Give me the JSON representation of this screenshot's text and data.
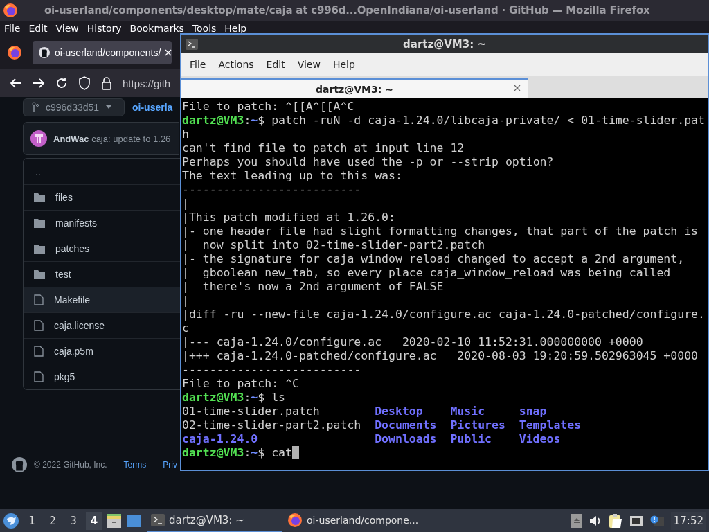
{
  "firefox": {
    "title": "oi-userland/components/desktop/mate/caja at c996d...OpenIndiana/oi-userland · GitHub — Mozilla Firefox",
    "menu": [
      "File",
      "Edit",
      "View",
      "History",
      "Bookmarks",
      "Tools",
      "Help"
    ],
    "tab": {
      "title": "oi-userland/components/"
    },
    "url": "https://gith",
    "page": {
      "branch": "c996d33d51",
      "repo_link": "oi-userla",
      "commit": {
        "author": "AndWac",
        "message": "caja: update to 1.26"
      },
      "files": [
        {
          "name": "..",
          "kind": "parent",
          "hovered": false
        },
        {
          "name": "files",
          "kind": "folder",
          "hovered": false
        },
        {
          "name": "manifests",
          "kind": "folder",
          "hovered": false
        },
        {
          "name": "patches",
          "kind": "folder",
          "hovered": false
        },
        {
          "name": "test",
          "kind": "folder",
          "hovered": false
        },
        {
          "name": "Makefile",
          "kind": "file",
          "hovered": true
        },
        {
          "name": "caja.license",
          "kind": "file",
          "hovered": false
        },
        {
          "name": "caja.p5m",
          "kind": "file",
          "hovered": false
        },
        {
          "name": "pkg5",
          "kind": "file",
          "hovered": false
        }
      ],
      "footer": {
        "copyright": "© 2022 GitHub, Inc.",
        "links": [
          "Terms",
          "Priv"
        ]
      }
    }
  },
  "terminal": {
    "title": "dartz@VM3: ~",
    "menu": [
      "File",
      "Actions",
      "Edit",
      "View",
      "Help"
    ],
    "tabs": [
      {
        "label": "dartz@VM3: ~",
        "selected": true
      }
    ],
    "cursor": true,
    "lines": [
      {
        "kind": "output",
        "segments": [
          {
            "kind": "text",
            "text": "File to patch: ^[[A^[[A^C"
          }
        ]
      },
      {
        "kind": "output",
        "segments": [
          {
            "kind": "user",
            "text": "dartz@VM3"
          },
          {
            "kind": "text",
            "text": ":"
          },
          {
            "kind": "path",
            "text": "~"
          },
          {
            "kind": "text",
            "text": "$ patch -ruN -d caja-1.24.0/libcaja-private/ < 01-time-slider.pat"
          }
        ]
      },
      {
        "kind": "output",
        "segments": [
          {
            "kind": "text",
            "text": "h"
          }
        ]
      },
      {
        "kind": "output",
        "segments": [
          {
            "kind": "text",
            "text": "can't find file to patch at input line 12"
          }
        ]
      },
      {
        "kind": "output",
        "segments": [
          {
            "kind": "text",
            "text": "Perhaps you should have used the -p or --strip option?"
          }
        ]
      },
      {
        "kind": "output",
        "segments": [
          {
            "kind": "text",
            "text": "The text leading up to this was:"
          }
        ]
      },
      {
        "kind": "output",
        "segments": [
          {
            "kind": "text",
            "text": "--------------------------"
          }
        ]
      },
      {
        "kind": "output",
        "segments": [
          {
            "kind": "text",
            "text": "|"
          }
        ]
      },
      {
        "kind": "output",
        "segments": [
          {
            "kind": "text",
            "text": "|This patch modified at 1.26.0:"
          }
        ]
      },
      {
        "kind": "output",
        "segments": [
          {
            "kind": "text",
            "text": "|- one header file had slight formatting changes, that part of the patch is"
          }
        ]
      },
      {
        "kind": "output",
        "segments": [
          {
            "kind": "text",
            "text": "|  now split into 02-time-slider-part2.patch"
          }
        ]
      },
      {
        "kind": "output",
        "segments": [
          {
            "kind": "text",
            "text": "|- the signature for caja_window_reload changed to accept a 2nd argument,"
          }
        ]
      },
      {
        "kind": "output",
        "segments": [
          {
            "kind": "text",
            "text": "|  gboolean new_tab, so every place caja_window_reload was being called"
          }
        ]
      },
      {
        "kind": "output",
        "segments": [
          {
            "kind": "text",
            "text": "|  there's now a 2nd argument of FALSE"
          }
        ]
      },
      {
        "kind": "output",
        "segments": [
          {
            "kind": "text",
            "text": "|"
          }
        ]
      },
      {
        "kind": "output",
        "segments": [
          {
            "kind": "text",
            "text": "|diff -ru --new-file caja-1.24.0/configure.ac caja-1.24.0-patched/configure."
          }
        ]
      },
      {
        "kind": "output",
        "segments": [
          {
            "kind": "text",
            "text": "c"
          }
        ]
      },
      {
        "kind": "output",
        "segments": [
          {
            "kind": "text",
            "text": "|--- caja-1.24.0/configure.ac   2020-02-10 11:52:31.000000000 +0000"
          }
        ]
      },
      {
        "kind": "output",
        "segments": [
          {
            "kind": "text",
            "text": "|+++ caja-1.24.0-patched/configure.ac   2020-08-03 19:20:59.502963045 +0000"
          }
        ]
      },
      {
        "kind": "output",
        "segments": [
          {
            "kind": "text",
            "text": "--------------------------"
          }
        ]
      },
      {
        "kind": "output",
        "segments": [
          {
            "kind": "text",
            "text": "File to patch: ^C"
          }
        ]
      },
      {
        "kind": "output",
        "segments": [
          {
            "kind": "user",
            "text": "dartz@VM3"
          },
          {
            "kind": "text",
            "text": ":"
          },
          {
            "kind": "path",
            "text": "~"
          },
          {
            "kind": "text",
            "text": "$ ls"
          }
        ]
      },
      {
        "kind": "ls",
        "entries": [
          {
            "kind": "text",
            "text": "01-time-slider.patch"
          },
          {
            "kind": "dir",
            "text": "Desktop"
          },
          {
            "kind": "dir",
            "text": "Music"
          },
          {
            "kind": "dir",
            "text": "snap"
          }
        ]
      },
      {
        "kind": "ls",
        "entries": [
          {
            "kind": "text",
            "text": "02-time-slider-part2.patch"
          },
          {
            "kind": "dir",
            "text": "Documents"
          },
          {
            "kind": "dir",
            "text": "Pictures"
          },
          {
            "kind": "dir",
            "text": "Templates"
          }
        ]
      },
      {
        "kind": "ls",
        "entries": [
          {
            "kind": "dir",
            "text": "caja-1.24.0"
          },
          {
            "kind": "dir",
            "text": "Downloads"
          },
          {
            "kind": "dir",
            "text": "Public"
          },
          {
            "kind": "dir",
            "text": "Videos"
          }
        ]
      },
      {
        "kind": "output",
        "segments": [
          {
            "kind": "user",
            "text": "dartz@VM3"
          },
          {
            "kind": "text",
            "text": ":"
          },
          {
            "kind": "path",
            "text": "~"
          },
          {
            "kind": "text",
            "text": "$ cat"
          }
        ]
      }
    ]
  },
  "taskbar": {
    "workspaces": [
      {
        "label": "1",
        "selected": false
      },
      {
        "label": "2",
        "selected": false
      },
      {
        "label": "3",
        "selected": false
      },
      {
        "label": "4",
        "selected": true
      }
    ],
    "tasks": [
      {
        "label": "dartz@VM3: ~",
        "kind": "terminal",
        "selected": true
      },
      {
        "label": "oi-userland/compone...",
        "kind": "firefox",
        "selected": false
      }
    ],
    "clock": "17:52"
  }
}
